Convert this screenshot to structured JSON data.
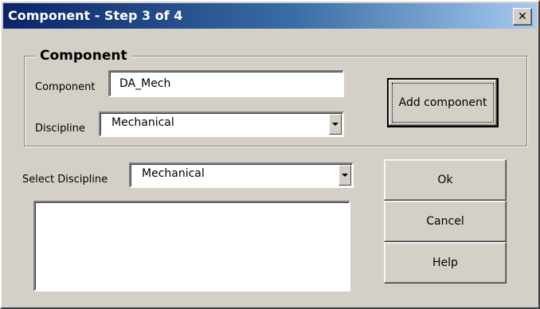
{
  "window": {
    "title": "Component - Step 3 of 4",
    "close_glyph": "✕"
  },
  "component_group": {
    "legend": "Component",
    "component_label": "Component",
    "component_value": "DA_Mech",
    "discipline_label": "Discipline",
    "discipline_value": "Mechanical"
  },
  "buttons": {
    "add_component": "Add component",
    "ok": "Ok",
    "cancel": "Cancel",
    "help": "Help"
  },
  "select_discipline": {
    "label": "Select Discipline",
    "value": "Mechanical"
  },
  "components_list": {
    "items": []
  },
  "colors": {
    "dialog_face": "#d4d0c8",
    "title_start": "#0a246a",
    "title_end": "#a6caf0",
    "field_bg": "#ffffff"
  },
  "icons": {
    "close": "close-icon",
    "dropdown": "chevron-down-icon"
  }
}
